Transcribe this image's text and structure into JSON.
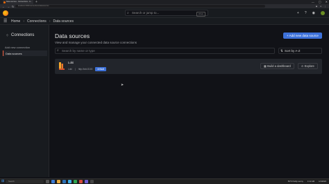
{
  "browser": {
    "tab_title": "Data sources - Connections - G...",
    "new_tab": "+",
    "url": "localhost:3000/connections/datasources",
    "window_controls": [
      "—",
      "▢",
      "✕"
    ]
  },
  "topbar": {
    "search_placeholder": "Search or jump to...",
    "search_shortcut": "ctrl+k",
    "icons": [
      "plus-icon",
      "help-icon",
      "rss-icon",
      "avatar"
    ]
  },
  "breadcrumb": {
    "items": [
      "Home",
      "Connections",
      "Data sources"
    ],
    "separator": "›"
  },
  "sidebar": {
    "title": "Connections",
    "items": [
      {
        "label": "Add new connection"
      },
      {
        "label": "Data sources"
      }
    ]
  },
  "main": {
    "title": "Data sources",
    "subtitle": "View and manage your connected data source connections",
    "add_button": "+ Add new data source",
    "filter_placeholder": "Search by name or type",
    "sort_label": "Sort by A-Z",
    "datasources": [
      {
        "name": "Loki",
        "type": "Loki",
        "url": "http://loki:3100",
        "badge": "default",
        "build_label": "Build a dashboard",
        "explore_label": "Explore"
      }
    ]
  },
  "taskbar": {
    "search_placeholder": "Search",
    "weather": "59°F  Partly sunny",
    "time": "1:12 AM",
    "date": "1/1/2024"
  },
  "colors": {
    "accent": "#3d71d9",
    "active_marker": "#f55f3e",
    "background": "#111217",
    "panel": "#181b1f"
  }
}
